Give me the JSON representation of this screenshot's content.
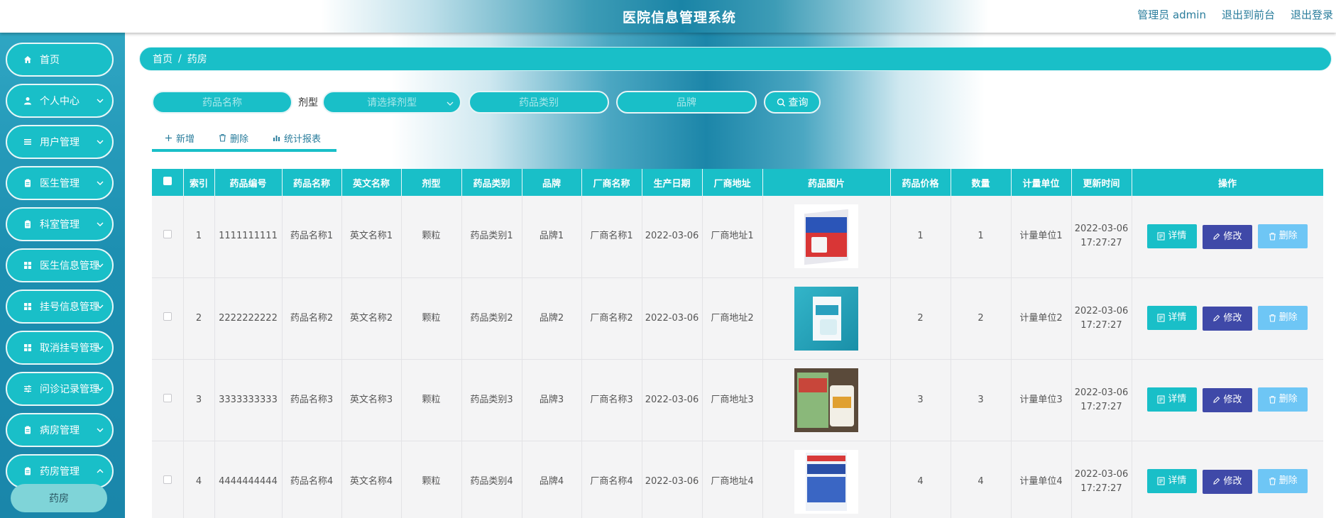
{
  "header": {
    "title": "医院信息管理系统",
    "admin_label": "管理员 admin",
    "to_front": "退出到前台",
    "logout": "退出登录"
  },
  "sidebar": {
    "items": [
      {
        "label": "首页",
        "icon": "home-icon"
      },
      {
        "label": "个人中心",
        "icon": "user-icon"
      },
      {
        "label": "用户管理",
        "icon": "list-icon"
      },
      {
        "label": "医生管理",
        "icon": "clipboard-icon"
      },
      {
        "label": "科室管理",
        "icon": "clipboard-icon"
      },
      {
        "label": "医生信息管理",
        "icon": "grid-icon"
      },
      {
        "label": "挂号信息管理",
        "icon": "grid-icon"
      },
      {
        "label": "取消挂号管理",
        "icon": "grid-icon"
      },
      {
        "label": "问诊记录管理",
        "icon": "sliders-icon"
      },
      {
        "label": "病房管理",
        "icon": "clipboard-icon"
      },
      {
        "label": "药房管理",
        "icon": "clipboard-icon"
      }
    ],
    "sub_item": "药房"
  },
  "breadcrumb": {
    "home": "首页",
    "sep": "/",
    "current": "药房"
  },
  "search": {
    "name_placeholder": "药品名称",
    "dosage_label": "剂型",
    "dosage_placeholder": "请选择剂型",
    "category_placeholder": "药品类别",
    "brand_placeholder": "品牌",
    "query_button": "查询"
  },
  "actions": {
    "add": "新增",
    "delete": "删除",
    "report": "统计报表"
  },
  "table": {
    "headers": [
      "索引",
      "药品编号",
      "药品名称",
      "英文名称",
      "剂型",
      "药品类别",
      "品牌",
      "厂商名称",
      "生产日期",
      "厂商地址",
      "药品图片",
      "药品价格",
      "数量",
      "计量单位",
      "更新时间",
      "操作"
    ],
    "rows": [
      {
        "index": "1",
        "code": "1111111111",
        "name": "药品名称1",
        "en_name": "英文名称1",
        "dosage": "颗粒",
        "category": "药品类别1",
        "brand": "品牌1",
        "maker": "厂商名称1",
        "date": "2022-03-06",
        "address": "厂商地址1",
        "price": "1",
        "qty": "1",
        "unit": "计量单位1",
        "updated": "2022-03-06 17:27:27"
      },
      {
        "index": "2",
        "code": "2222222222",
        "name": "药品名称2",
        "en_name": "英文名称2",
        "dosage": "颗粒",
        "category": "药品类别2",
        "brand": "品牌2",
        "maker": "厂商名称2",
        "date": "2022-03-06",
        "address": "厂商地址2",
        "price": "2",
        "qty": "2",
        "unit": "计量单位2",
        "updated": "2022-03-06 17:27:27"
      },
      {
        "index": "3",
        "code": "3333333333",
        "name": "药品名称3",
        "en_name": "英文名称3",
        "dosage": "颗粒",
        "category": "药品类别3",
        "brand": "品牌3",
        "maker": "厂商名称3",
        "date": "2022-03-06",
        "address": "厂商地址3",
        "price": "3",
        "qty": "3",
        "unit": "计量单位3",
        "updated": "2022-03-06 17:27:27"
      },
      {
        "index": "4",
        "code": "4444444444",
        "name": "药品名称4",
        "en_name": "英文名称4",
        "dosage": "颗粒",
        "category": "药品类别4",
        "brand": "品牌4",
        "maker": "厂商名称4",
        "date": "2022-03-06",
        "address": "厂商地址4",
        "price": "4",
        "qty": "4",
        "unit": "计量单位4",
        "updated": "2022-03-06 17:27:27"
      }
    ],
    "row_buttons": {
      "detail": "详情",
      "edit": "修改",
      "delete": "删除"
    }
  },
  "colors": {
    "accent": "#19bfc8",
    "edit_button": "#3f49a8",
    "delete_button": "#6ec6f5",
    "sidebar_bg": "#1d8fb1"
  }
}
